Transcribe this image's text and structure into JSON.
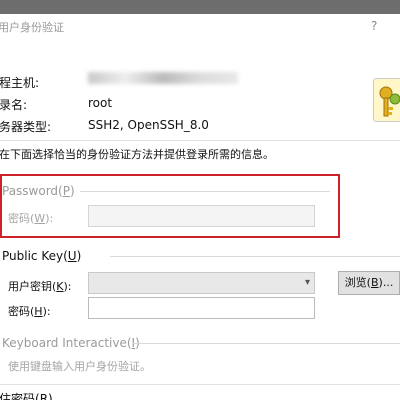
{
  "window": {
    "title": "用户身份验证",
    "help": "?"
  },
  "info": {
    "host_label": "程主机:",
    "host_value": "",
    "user_label": "录名:",
    "user_value": "root",
    "server_type_label": "务器类型:",
    "server_type_value": "SSH2, OpenSSH_8.0"
  },
  "instruction": "在下面选择恰当的身份验证方法并提供登录所需的信息。",
  "password_section": {
    "title": "Password(",
    "title_key": "P",
    "title_end": ")",
    "password_label": "密码(",
    "password_key": "W",
    "password_end": "):",
    "password_value": ""
  },
  "public_key_section": {
    "title": "Public Key(",
    "title_key": "U",
    "title_end": ")",
    "user_key_label": "用户密钥(",
    "user_key_key": "K",
    "user_key_end": "):",
    "user_key_value": "",
    "browse_label": "浏览(",
    "browse_key": "B",
    "browse_end": ")...",
    "passphrase_label": "密码(",
    "passphrase_key": "H",
    "passphrase_end": "):",
    "passphrase_value": ""
  },
  "keyboard_section": {
    "title": "Keyboard Interactive(",
    "title_key": "I",
    "title_end": ")",
    "description": "使用键盘输入用户身份验证。"
  },
  "bottom": {
    "remember_label": "住密码(",
    "remember_key": "R",
    "remember_end": ")"
  },
  "colors": {
    "highlight": "#d0202a",
    "disabled_text": "#9a9a9a"
  }
}
